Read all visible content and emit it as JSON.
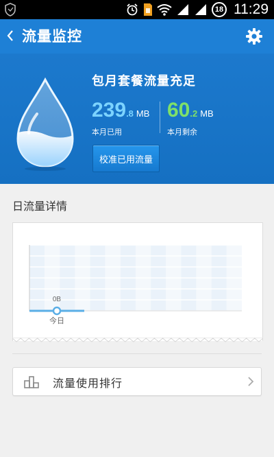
{
  "status_bar": {
    "time": "11:29",
    "badge": "18"
  },
  "app_bar": {
    "title": "流量监控"
  },
  "hero": {
    "title": "包月套餐流量充足",
    "used": {
      "int": "239",
      "dec": ".8",
      "unit": "MB",
      "caption": "本月已用"
    },
    "remaining": {
      "int": "60",
      "dec": ".2",
      "unit": "MB",
      "caption": "本月剩余"
    },
    "calibrate_label": "校准已用流量"
  },
  "daily": {
    "section_title": "日流量详情"
  },
  "chart_data": {
    "type": "line",
    "x": [
      "今日"
    ],
    "values": [
      0
    ],
    "point_labels": [
      "0B"
    ],
    "title": "",
    "xlabel": "",
    "ylabel": "",
    "grid": true
  },
  "ranking": {
    "label": "流量使用排行"
  },
  "colors": {
    "app_bar": "#1e80d6",
    "hero_bg": "#1572c4",
    "used_value": "#7cd3ff",
    "remaining_value": "#7ee06a",
    "chart_line": "#5aaee6"
  }
}
